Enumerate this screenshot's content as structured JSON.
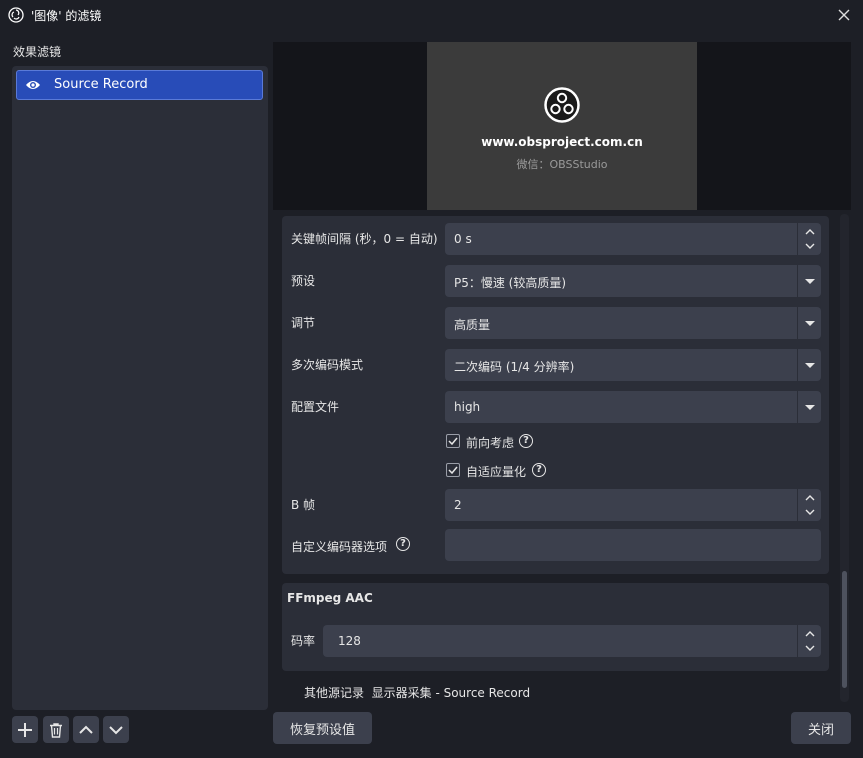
{
  "window": {
    "title": "'图像' 的滤镜"
  },
  "sidebar": {
    "label": "效果滤镜",
    "filters": [
      {
        "name": "Source Record",
        "visible_icon": "eye-icon"
      }
    ],
    "buttons": [
      "plus-icon",
      "trash-icon",
      "chevron-up-icon",
      "chevron-down-icon"
    ]
  },
  "preview": {
    "url_text": "www.obsproject.com.cn",
    "wechat_text": "微信：OBSStudio"
  },
  "settings": {
    "keyframe_label": "关键帧间隔 (秒，0 = 自动)",
    "keyframe_value": "0 s",
    "preset_label": "预设",
    "preset_value": "P5：慢速 (较高质量)",
    "tuning_label": "调节",
    "tuning_value": "高质量",
    "multipass_label": "多次编码模式",
    "multipass_value": "二次编码 (1/4 分辨率)",
    "profile_label": "配置文件",
    "profile_value": "high",
    "lookahead_label": "前向考虑",
    "lookahead_checked": true,
    "adaptive_label": "自适应量化",
    "adaptive_checked": true,
    "bframes_label": "B 帧",
    "bframes_value": "2",
    "custom_label": "自定义编码器选项",
    "custom_value": ""
  },
  "audio": {
    "header": "FFmpeg AAC",
    "bitrate_label": "码率",
    "bitrate_value": "128"
  },
  "footer_note": "其他源记录  显示器采集 - Source Record",
  "buttons": {
    "reset": "恢复预设值",
    "close": "关闭"
  },
  "help_glyph": "?"
}
